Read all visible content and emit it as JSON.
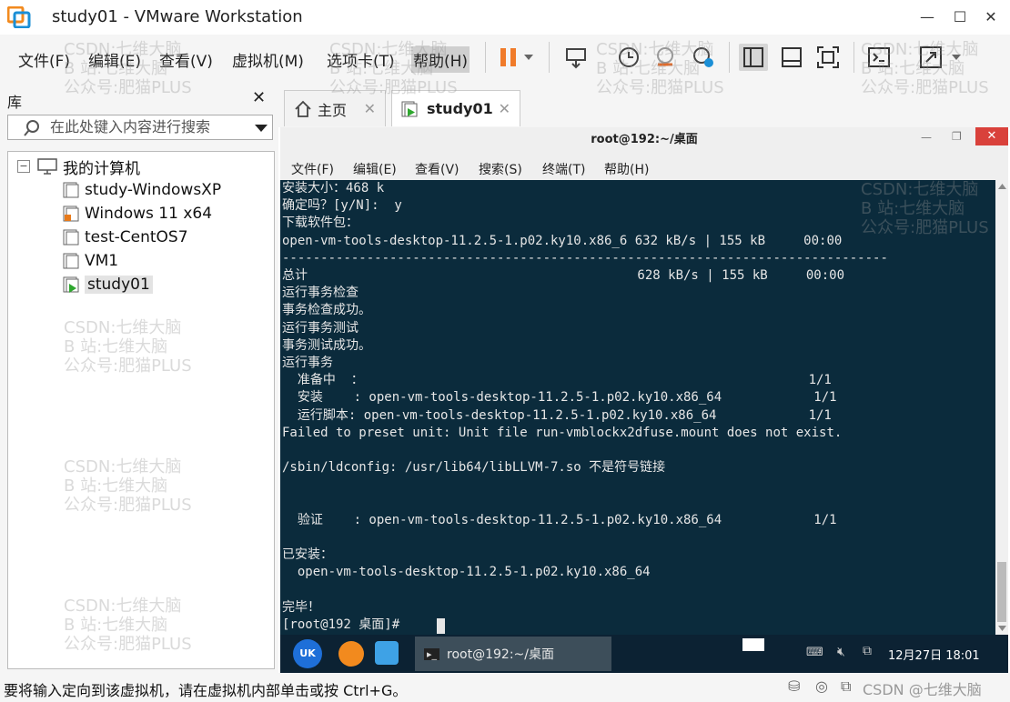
{
  "window": {
    "title": "study01 - VMware Workstation",
    "minimize": "—",
    "maximize": "☐",
    "close": "✕"
  },
  "menu": [
    "文件(F)",
    "编辑(E)",
    "查看(V)",
    "虚拟机(M)",
    "选项卡(T)",
    "帮助(H)"
  ],
  "library": {
    "title": "库",
    "close": "✕",
    "search_placeholder": "在此处键入内容进行搜索",
    "root": "我的计算机",
    "items": [
      "study-WindowsXP",
      "Windows 11 x64",
      "test-CentOS7",
      "VM1",
      "study01"
    ]
  },
  "tabs": {
    "home": "主页",
    "vm": "study01"
  },
  "terminal": {
    "title": "root@192:~/桌面",
    "menu": [
      "文件(F)",
      "编辑(E)",
      "查看(V)",
      "搜索(S)",
      "终端(T)",
      "帮助(H)"
    ],
    "lines": [
      "安装大小：468 k",
      "确定吗？[y/N]:  y",
      "下载软件包：",
      "open-vm-tools-desktop-11.2.5-1.p02.ky10.x86_6 632 kB/s | 155 kB     00:00",
      "-------------------------------------------------------------------------------",
      "总计                                           628 kB/s | 155 kB     00:00",
      "运行事务检查",
      "事务检查成功。",
      "运行事务测试",
      "事务测试成功。",
      "运行事务",
      "  准备中  ：                                                          1/1",
      "  安装    : open-vm-tools-desktop-11.2.5-1.p02.ky10.x86_64            1/1",
      "  运行脚本: open-vm-tools-desktop-11.2.5-1.p02.ky10.x86_64            1/1",
      "Failed to preset unit: Unit file run-vmblockx2dfuse.mount does not exist.",
      "",
      "/sbin/ldconfig: /usr/lib64/libLLVM-7.so 不是符号链接",
      "",
      "",
      "  验证    : open-vm-tools-desktop-11.2.5-1.p02.ky10.x86_64            1/1",
      "",
      "已安装：",
      "  open-vm-tools-desktop-11.2.5-1.p02.ky10.x86_64",
      "",
      "完毕！",
      "[root@192 桌面]# "
    ]
  },
  "taskbar": {
    "window_title": "root@192:~/桌面",
    "datetime": "12月27日 18:01"
  },
  "status": {
    "text": "要将输入定向到该虚拟机，请在虚拟机内部单击或按 Ctrl+G。"
  },
  "watermark": {
    "line1": "CSDN:七维大脑",
    "line2": "B 站:七维大脑",
    "line3": "公众号:肥猫PLUS",
    "corner": "CSDN @七维大脑"
  },
  "colors": {
    "terminal_bg": "#0b2b3c",
    "accent_pause": "#f07b2a",
    "taskbar_bg": "#0c2233"
  }
}
